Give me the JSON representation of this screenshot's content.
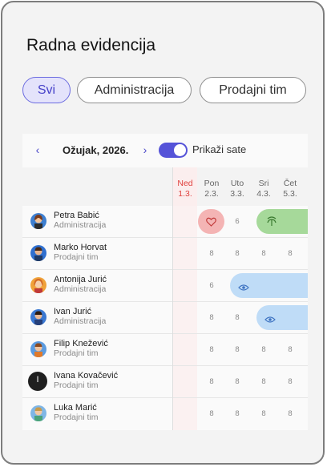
{
  "title": "Radna evidencija",
  "filters": [
    {
      "label": "Svi",
      "active": true
    },
    {
      "label": "Administracija",
      "active": false
    },
    {
      "label": "Prodajni tim",
      "active": false
    }
  ],
  "calendar": {
    "month_label": "Ožujak, 2026.",
    "prev_icon": "chevron-left-icon",
    "next_icon": "chevron-right-icon",
    "toggle_label": "Prikaži sate",
    "toggle_on": true,
    "days": [
      {
        "name": "Ned",
        "date": "1.3.",
        "weekend": true
      },
      {
        "name": "Pon",
        "date": "2.3."
      },
      {
        "name": "Uto",
        "date": "3.3."
      },
      {
        "name": "Sri",
        "date": "4.3."
      },
      {
        "name": "Čet",
        "date": "5.3."
      }
    ]
  },
  "employees": [
    {
      "name": "Petra Babić",
      "dept": "Administracija",
      "hours": [
        "",
        "",
        "6",
        "",
        ""
      ],
      "absence": {
        "type": "sick-leave",
        "icon": "heart-icon",
        "color": "#f4b4b4"
      },
      "absence2": {
        "type": "vacation",
        "icon": "palm-tree-icon",
        "color": "#a6d99a"
      }
    },
    {
      "name": "Marko Horvat",
      "dept": "Prodajni tim",
      "hours": [
        "",
        "8",
        "8",
        "8",
        "8"
      ]
    },
    {
      "name": "Antonija Jurić",
      "dept": "Administracija",
      "hours": [
        "",
        "6",
        "",
        "",
        ""
      ],
      "absence": {
        "type": "leave",
        "icon": "eye-icon",
        "color": "#bfdcf7"
      }
    },
    {
      "name": "Ivan Jurić",
      "dept": "Administracija",
      "hours": [
        "",
        "8",
        "8",
        "",
        ""
      ],
      "absence": {
        "type": "leave",
        "icon": "eye-icon",
        "color": "#bfdcf7"
      }
    },
    {
      "name": "Filip Knežević",
      "dept": "Prodajni tim",
      "hours": [
        "",
        "8",
        "8",
        "8",
        "8"
      ]
    },
    {
      "name": "Ivana Kovačević",
      "dept": "Prodajni tim",
      "initial": "I",
      "hours": [
        "",
        "8",
        "8",
        "8",
        "8"
      ]
    },
    {
      "name": "Luka Marić",
      "dept": "Prodajni tim",
      "hours": [
        "",
        "8",
        "8",
        "8",
        "8"
      ]
    }
  ],
  "colors": {
    "accent": "#5553d8",
    "sunday": "#e0413e"
  }
}
